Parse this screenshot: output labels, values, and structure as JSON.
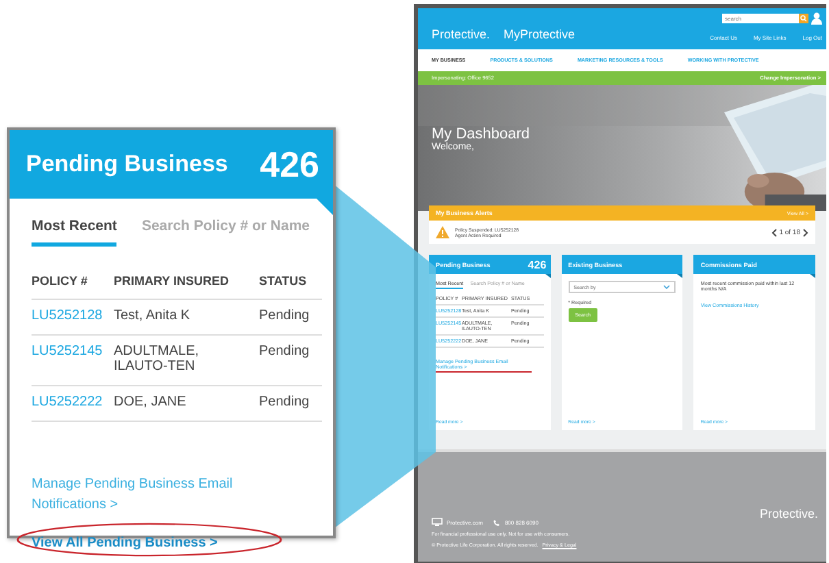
{
  "callout": {
    "title": "Pending Business",
    "count": "426",
    "tabs": [
      {
        "label": "Most Recent",
        "selected": true
      },
      {
        "label": "Search Policy # or Name",
        "selected": false
      }
    ],
    "columns": [
      "POLICY #",
      "PRIMARY INSURED",
      "STATUS"
    ],
    "rows": [
      {
        "policy": "LU5252128",
        "insured": "Test, Anita K",
        "status": "Pending"
      },
      {
        "policy": "LU5252145",
        "insured": "ADULTMALE, ILAUTO-TEN",
        "status": "Pending"
      },
      {
        "policy": "LU5252222",
        "insured": "DOE, JANE",
        "status": "Pending"
      }
    ],
    "manage_link": "Manage Pending Business Email Notifications >",
    "view_all_link": "View All Pending Business >",
    "view_all_circled": true
  },
  "site": {
    "header": {
      "logo": "Protective.",
      "app_name": "MyProtective",
      "search": {
        "placeholder": "search"
      },
      "links": [
        "Contact Us",
        "My Site Links",
        "Log Out"
      ]
    },
    "nav": [
      {
        "label": "MY BUSINESS",
        "selected": true
      },
      {
        "label": "PRODUCTS & SOLUTIONS",
        "selected": false
      },
      {
        "label": "MARKETING RESOURCES & TOOLS",
        "selected": false
      },
      {
        "label": "WORKING WITH PROTECTIVE",
        "selected": false
      }
    ],
    "impersonation": {
      "text": "Impersonating: Office 9652",
      "link": "Change Impersonation >"
    },
    "hero": {
      "title": "My Dashboard",
      "welcome": "Welcome,"
    },
    "alerts": {
      "title": "My Business Alerts",
      "view_all": "View All >",
      "message": "Policy Suspended: LU5252128",
      "detail": "Agent Action Required",
      "pager": "1 of 18"
    },
    "pending": {
      "title": "Pending Business",
      "count": "426",
      "tabs": [
        {
          "label": "Most Recent",
          "selected": true
        },
        {
          "label": "Search Policy # or Name",
          "selected": false
        }
      ],
      "columns": [
        "POLICY #",
        "PRIMARY INSURED",
        "STATUS"
      ],
      "rows": [
        {
          "policy": "LU5252128",
          "insured": "Test, Anita K",
          "status": "Pending"
        },
        {
          "policy": "LU5252145",
          "insured": "ADULTMALE, ILAUTO-TEN",
          "status": "Pending"
        },
        {
          "policy": "LU5252222",
          "insured": "DOE, JANE",
          "status": "Pending"
        }
      ],
      "manage_link": "Manage Pending Business Email Notifications >",
      "manage_underlined": true,
      "read_more": "Read more >"
    },
    "existing": {
      "title": "Existing Business",
      "select": "Search by",
      "required": "* Required",
      "button": "Search",
      "read_more": "Read more >"
    },
    "commissions": {
      "title": "Commissions Paid",
      "text": "Most recent commission paid within last 12 months N/A",
      "link": "View Commissions History",
      "read_more": "Read more >"
    },
    "footer": {
      "site": "Protective.com",
      "phone": "800 828 6090",
      "disclaimer": "For financial professional use only. Not for use with consumers.",
      "copyright": "© Protective Life Corporation. All rights reserved.",
      "legal_link": "Privacy & Legal",
      "logo": "Protective."
    }
  }
}
